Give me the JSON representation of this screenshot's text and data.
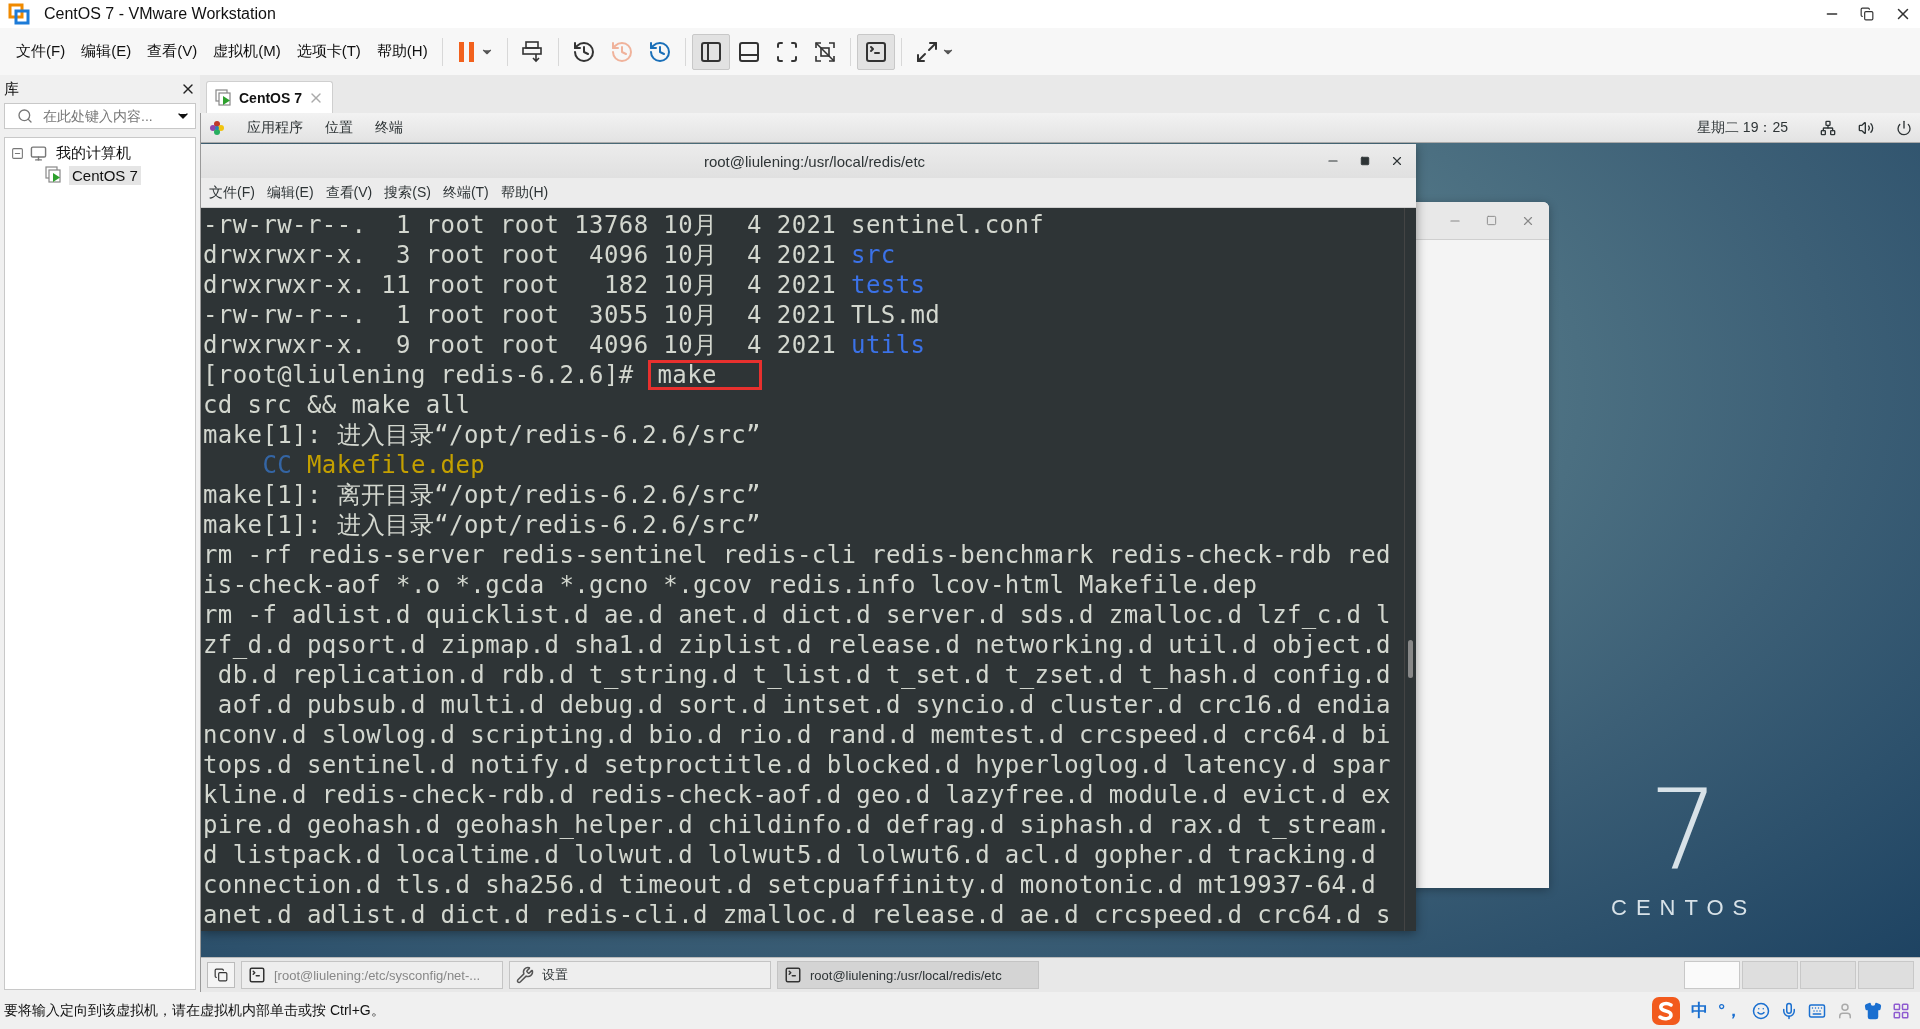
{
  "window": {
    "title": "CentOS 7 - VMware Workstation"
  },
  "menu": [
    "文件(F)",
    "编辑(E)",
    "查看(V)",
    "虚拟机(M)",
    "选项卡(T)",
    "帮助(H)"
  ],
  "toolbar_groups": [
    {
      "buttons": [
        {
          "kind": "pause",
          "selected": false,
          "disabled": false,
          "dropdown": true
        }
      ]
    },
    {
      "buttons": [
        {
          "kind": "send_keys",
          "selected": false,
          "disabled": false,
          "dropdown": false
        }
      ]
    },
    {
      "buttons": [
        {
          "kind": "snapshot",
          "selected": false,
          "disabled": false,
          "dropdown": false
        },
        {
          "kind": "revert",
          "selected": false,
          "disabled": true,
          "dropdown": false
        },
        {
          "kind": "snapshot_manager",
          "selected": false,
          "disabled": false,
          "dropdown": false
        }
      ]
    },
    {
      "buttons": [
        {
          "kind": "library_view",
          "selected": true,
          "disabled": false,
          "dropdown": false
        },
        {
          "kind": "thumbnail_view",
          "selected": false,
          "disabled": false,
          "dropdown": false
        },
        {
          "kind": "full_screen",
          "selected": false,
          "disabled": false,
          "dropdown": false
        },
        {
          "kind": "unity",
          "selected": false,
          "disabled": false,
          "dropdown": false
        }
      ]
    },
    {
      "buttons": [
        {
          "kind": "console_view",
          "selected": true,
          "disabled": false,
          "dropdown": false
        }
      ]
    },
    {
      "buttons": [
        {
          "kind": "stretch",
          "selected": false,
          "disabled": false,
          "dropdown": true
        }
      ]
    }
  ],
  "library": {
    "title": "库",
    "search_placeholder": "在此处键入内容...",
    "tree": [
      {
        "label": "我的计算机",
        "expanded": true,
        "children": [
          {
            "label": "CentOS 7",
            "selected": true
          }
        ]
      }
    ]
  },
  "tabs": [
    {
      "label": "CentOS 7",
      "selected": true
    }
  ],
  "guest": {
    "topbar": {
      "menus": [
        "应用程序",
        "位置",
        "终端"
      ],
      "clock": "星期二 19：25"
    },
    "back_window": {
      "kind": "window"
    },
    "terminal": {
      "title": "root@liulening:/usr/local/redis/etc",
      "menu": [
        "文件(F)",
        "编辑(E)",
        "查看(V)",
        "搜索(S)",
        "终端(T)",
        "帮助(H)"
      ],
      "lines": [
        {
          "segments": [
            {
              "text": "-rw-rw-r--.  1 root root 13768 10月  4 2021 ",
              "kind": "plain",
              "highlighted": false
            },
            {
              "text": "sentinel.conf",
              "kind": "plain",
              "highlighted": false
            }
          ]
        },
        {
          "segments": [
            {
              "text": "drwxrwxr-x.  3 root root  4096 10月  4 2021 ",
              "kind": "plain",
              "highlighted": false
            },
            {
              "text": "src",
              "kind": "dir",
              "highlighted": false
            }
          ]
        },
        {
          "segments": [
            {
              "text": "drwxrwxr-x. 11 root root   182 10月  4 2021 ",
              "kind": "plain",
              "highlighted": false
            },
            {
              "text": "tests",
              "kind": "dir",
              "highlighted": false
            }
          ]
        },
        {
          "segments": [
            {
              "text": "-rw-rw-r--.  1 root root  3055 10月  4 2021 ",
              "kind": "plain",
              "highlighted": false
            },
            {
              "text": "TLS.md",
              "kind": "plain",
              "highlighted": false
            }
          ]
        },
        {
          "segments": [
            {
              "text": "drwxrwxr-x.  9 root root  4096 10月  4 2021 ",
              "kind": "plain",
              "highlighted": false
            },
            {
              "text": "utils",
              "kind": "dir",
              "highlighted": false
            }
          ]
        },
        {
          "segments": [
            {
              "text": "[root@liulening redis-6.2.6]# ",
              "kind": "plain",
              "highlighted": false
            },
            {
              "text": "make",
              "kind": "plain",
              "highlighted": true
            }
          ]
        },
        {
          "segments": [
            {
              "text": "cd src && make all",
              "kind": "plain",
              "highlighted": false
            }
          ]
        },
        {
          "segments": [
            {
              "text": "make[1]: 进入目录“/opt/redis-6.2.6/src”",
              "kind": "plain",
              "highlighted": false
            }
          ]
        },
        {
          "segments": [
            {
              "text": "    CC",
              "kind": "cc",
              "highlighted": false
            },
            {
              "text": " Makefile.dep",
              "kind": "target",
              "highlighted": false
            }
          ]
        },
        {
          "segments": [
            {
              "text": "make[1]: 离开目录“/opt/redis-6.2.6/src”",
              "kind": "plain",
              "highlighted": false
            }
          ]
        },
        {
          "segments": [
            {
              "text": "make[1]: 进入目录“/opt/redis-6.2.6/src”",
              "kind": "plain",
              "highlighted": false
            }
          ]
        },
        {
          "segments": [
            {
              "text": "rm -rf redis-server redis-sentinel redis-cli redis-benchmark redis-check-rdb red",
              "kind": "plain",
              "highlighted": false
            }
          ]
        },
        {
          "segments": [
            {
              "text": "is-check-aof *.o *.gcda *.gcno *.gcov redis.info lcov-html Makefile.dep",
              "kind": "plain",
              "highlighted": false
            }
          ]
        },
        {
          "segments": [
            {
              "text": "rm -f adlist.d quicklist.d ae.d anet.d dict.d server.d sds.d zmalloc.d lzf_c.d l",
              "kind": "plain",
              "highlighted": false
            }
          ]
        },
        {
          "segments": [
            {
              "text": "zf_d.d pqsort.d zipmap.d sha1.d ziplist.d release.d networking.d util.d object.d",
              "kind": "plain",
              "highlighted": false
            }
          ]
        },
        {
          "segments": [
            {
              "text": " db.d replication.d rdb.d t_string.d t_list.d t_set.d t_zset.d t_hash.d config.d",
              "kind": "plain",
              "highlighted": false
            }
          ]
        },
        {
          "segments": [
            {
              "text": " aof.d pubsub.d multi.d debug.d sort.d intset.d syncio.d cluster.d crc16.d endia",
              "kind": "plain",
              "highlighted": false
            }
          ]
        },
        {
          "segments": [
            {
              "text": "nconv.d slowlog.d scripting.d bio.d rio.d rand.d memtest.d crcspeed.d crc64.d bi",
              "kind": "plain",
              "highlighted": false
            }
          ]
        },
        {
          "segments": [
            {
              "text": "tops.d sentinel.d notify.d setproctitle.d blocked.d hyperloglog.d latency.d spar",
              "kind": "plain",
              "highlighted": false
            }
          ]
        },
        {
          "segments": [
            {
              "text": "kline.d redis-check-rdb.d redis-check-aof.d geo.d lazyfree.d module.d evict.d ex",
              "kind": "plain",
              "highlighted": false
            }
          ]
        },
        {
          "segments": [
            {
              "text": "pire.d geohash.d geohash_helper.d childinfo.d defrag.d siphash.d rax.d t_stream.",
              "kind": "plain",
              "highlighted": false
            }
          ]
        },
        {
          "segments": [
            {
              "text": "d listpack.d localtime.d lolwut.d lolwut5.d lolwut6.d acl.d gopher.d tracking.d",
              "kind": "plain",
              "highlighted": false
            }
          ]
        },
        {
          "segments": [
            {
              "text": "connection.d tls.d sha256.d timeout.d setcpuaffinity.d monotonic.d mt19937-64.d",
              "kind": "plain",
              "highlighted": false
            }
          ]
        },
        {
          "segments": [
            {
              "text": "anet.d adlist.d dict.d redis-cli.d zmalloc.d release.d ae.d crcspeed.d crc64.d s",
              "kind": "plain",
              "highlighted": false
            }
          ]
        }
      ]
    },
    "logo": {
      "digit": "7",
      "word": "CENTOS"
    },
    "taskbar": {
      "tasks": [
        {
          "label": "[root@liulening:/etc/sysconfig/net-...",
          "kind": "terminal",
          "selected": false,
          "minimized": true
        },
        {
          "label": "设置",
          "kind": "settings",
          "selected": false,
          "minimized": false
        },
        {
          "label": "root@liulening:/usr/local/redis/etc",
          "kind": "terminal",
          "selected": true,
          "minimized": false
        }
      ],
      "workspaces": [
        {
          "selected": true
        },
        {
          "selected": false
        },
        {
          "selected": false
        },
        {
          "selected": false
        }
      ]
    }
  },
  "status_bar": {
    "message": "要将输入定向到该虚拟机，请在虚拟机内部单击或按 Ctrl+G。",
    "ime_language": "中",
    "ime_punctuation": "°，"
  }
}
